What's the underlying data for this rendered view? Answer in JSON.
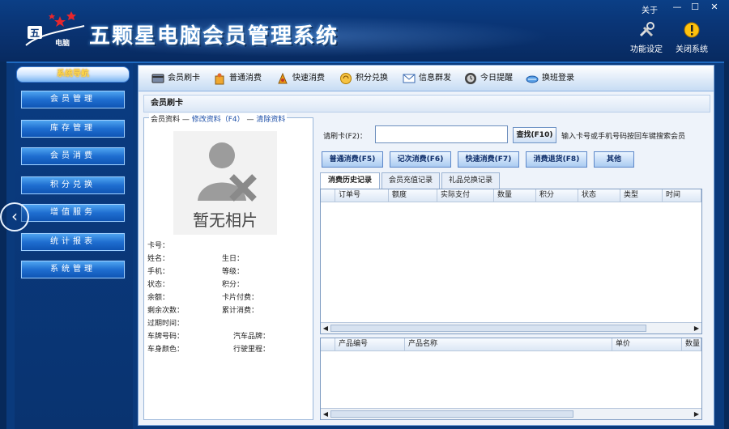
{
  "app": {
    "title": "五颗星电脑会员管理系统",
    "logo_text_top": "五",
    "logo_text_bottom": "电脑"
  },
  "window": {
    "about": "关于",
    "minimize": "—",
    "maximize": "☐",
    "close": "✕"
  },
  "header_tools": [
    {
      "label": "功能设定",
      "icon": "tools-icon"
    },
    {
      "label": "关闭系统",
      "icon": "warning-icon"
    }
  ],
  "nav": {
    "header": "系统导航",
    "items": [
      "会员管理",
      "库存管理",
      "会员消费",
      "积分兑换",
      "增值服务",
      "统计报表",
      "系统管理"
    ]
  },
  "toolbar": [
    {
      "label": "会员刷卡",
      "icon": "card-icon"
    },
    {
      "label": "普通消费",
      "icon": "bag-icon"
    },
    {
      "label": "快速消费",
      "icon": "fast-icon"
    },
    {
      "label": "积分兑换",
      "icon": "exchange-icon"
    },
    {
      "label": "信息群发",
      "icon": "message-icon"
    },
    {
      "label": "今日提醒",
      "icon": "clock-icon"
    },
    {
      "label": "换班登录",
      "icon": "login-icon"
    }
  ],
  "section_title": "会员刷卡",
  "member": {
    "legend_prefix": "会员资料",
    "legend_edit": "修改资料（F4）",
    "legend_clear": "清除资料",
    "photo_placeholder": "暂无相片",
    "fields_left": [
      "卡号：",
      "姓名：",
      "手机：",
      "状态：",
      "余额：",
      "剩余次数：",
      "过期时间：",
      "车牌号码：",
      "车身颜色："
    ],
    "fields_right": [
      "生日：",
      "等级：",
      "积分：",
      "卡片付费：",
      "累计消费：",
      "汽车品牌：",
      "行驶里程："
    ]
  },
  "search": {
    "label": "请刷卡(F2)：",
    "value": "",
    "button": "查找(F10)",
    "hint": "输入卡号或手机号码按回车键搜索会员"
  },
  "actions": [
    "普通消费(F5)",
    "记次消费(F6)",
    "快速消费(F7)",
    "消费退货(F8)",
    "其他"
  ],
  "tabs": [
    "消费历史记录",
    "会员充值记录",
    "礼品兑换记录"
  ],
  "grid1": {
    "columns": [
      "订单号",
      "额度",
      "实际支付",
      "数量",
      "积分",
      "状态",
      "类型",
      "时间"
    ]
  },
  "grid2": {
    "columns": [
      "产品编号",
      "产品名称",
      "单价",
      "数量"
    ]
  },
  "colors": {
    "header_bg": "#0a3576",
    "nav_item": "#1f6ed0",
    "accent": "#ffd84a"
  }
}
